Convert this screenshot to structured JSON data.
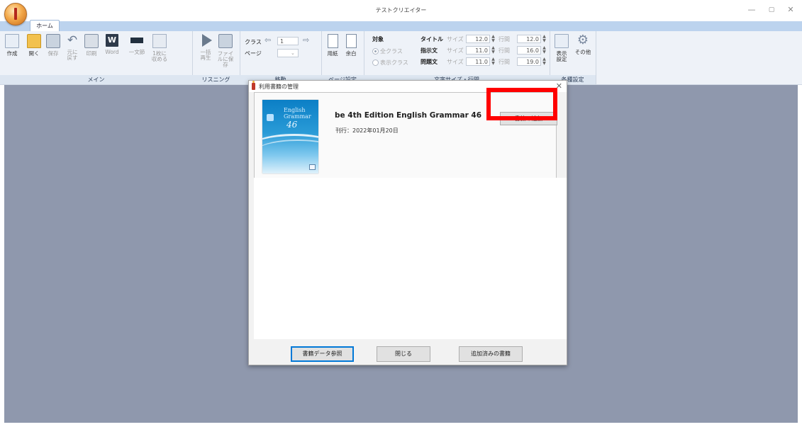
{
  "window": {
    "title": "テストクリエイター",
    "controls": {
      "minimize": "—",
      "maximize": "▢",
      "close": "✕"
    }
  },
  "ribbon": {
    "tab": "ホーム",
    "groups": {
      "main": {
        "label": "メイン",
        "buttons": {
          "create": "作成",
          "open": "開く",
          "save": "保存",
          "undo": "元に戻す",
          "print": "印刷",
          "word": "Word",
          "ichibunbu": "一文節",
          "onepage": "1枚に収める"
        }
      },
      "listening": {
        "label": "リスニング",
        "buttons": {
          "play_all": "一括再生",
          "save_file": "ファイルに保存"
        }
      },
      "move": {
        "label": "移動",
        "class_label": "クラス",
        "page_label": "ページ",
        "class_value": "1"
      },
      "page_setup": {
        "label": "ページ設定",
        "buttons": {
          "paper": "用紙",
          "margin": "余白"
        }
      },
      "text_size": {
        "label": "文字サイズ・行間",
        "target_label": "対象",
        "radio_all": "全クラス",
        "radio_display": "表示クラス",
        "rows": [
          {
            "name": "タイトル",
            "size_label": "サイズ",
            "size": "12.0",
            "spacing_label": "行間",
            "spacing": "12.0"
          },
          {
            "name": "指示文",
            "size_label": "サイズ",
            "size": "11.0",
            "spacing_label": "行間",
            "spacing": "16.0"
          },
          {
            "name": "問題文",
            "size_label": "サイズ",
            "size": "11.0",
            "spacing_label": "行間",
            "spacing": "19.0"
          }
        ]
      },
      "settings": {
        "label": "各種設定",
        "buttons": {
          "display": "表示設定",
          "other": "その他"
        }
      }
    }
  },
  "dialog": {
    "title": "利用書籍の管理",
    "close": "✕",
    "book": {
      "cover_title": "English Grammar",
      "cover_number": "46",
      "title": "be 4th Edition English Grammar 46",
      "date": "刊行：2022年01月20日"
    },
    "add_button": "書籍の追加",
    "buttons": {
      "reference": "書籍データ参照",
      "close": "閉じる",
      "added": "追加済みの書籍"
    }
  }
}
